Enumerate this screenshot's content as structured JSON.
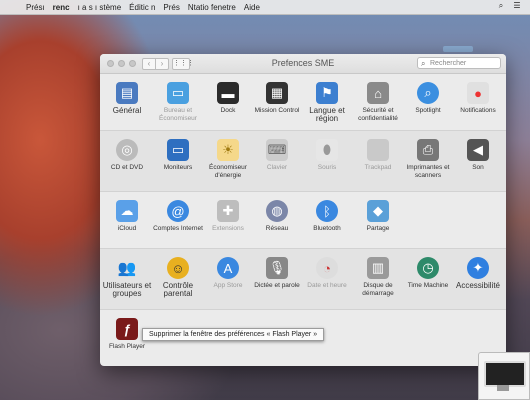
{
  "menubar": {
    "items": [
      "Présı",
      "renc",
      "ı a s ı stème",
      "Éditic n",
      "Prés",
      "Ntatio fenetre",
      "Aide"
    ]
  },
  "window": {
    "title": "Prefences SME",
    "search_placeholder": "Rechercher"
  },
  "row1": [
    {
      "name": "general",
      "label": "Général",
      "icon": "file-icon",
      "color": "#4a7ac0"
    },
    {
      "name": "bureau",
      "label": "Bureau et Économiseur",
      "icon": "desktop-icon",
      "color": "#4aa0e0"
    },
    {
      "name": "dock",
      "label": "Dock",
      "icon": "dock-icon",
      "color": "#2b2b2b"
    },
    {
      "name": "mission-control",
      "label": "Mission Control",
      "icon": "mission-icon",
      "color": "#333333"
    },
    {
      "name": "langue",
      "label": "Langue et région",
      "icon": "flag-icon",
      "color": "#3c7fd0"
    },
    {
      "name": "securite",
      "label": "Sécurité et confidentialité",
      "icon": "house-lock-icon",
      "color": "#8a8a8a"
    },
    {
      "name": "spotlight",
      "label": "Spotlight",
      "icon": "magnifier-icon",
      "color": "#3b8fe0"
    },
    {
      "name": "notifications",
      "label": "Notifications",
      "icon": "bell-badge-icon",
      "color": "#e0e0e0"
    }
  ],
  "row2": [
    {
      "name": "cd-dvd",
      "label": "CD et DVD",
      "icon": "disc-icon",
      "color": "#bbbbbb"
    },
    {
      "name": "moniteurs",
      "label": "Moniteurs",
      "icon": "monitor-icon",
      "color": "#2e6fc0"
    },
    {
      "name": "economiseur",
      "label": "Économiseur d'énergie",
      "icon": "bulb-icon",
      "color": "#f5d88a"
    },
    {
      "name": "clavier",
      "label": "Clavier",
      "icon": "keyboard-icon",
      "color": "#cccccc"
    },
    {
      "name": "souris",
      "label": "Souris",
      "icon": "mouse-icon",
      "color": "#e6e6e6"
    },
    {
      "name": "trackpad",
      "label": "Trackpad",
      "icon": "trackpad-icon",
      "color": "#c9c9c9"
    },
    {
      "name": "imprimantes",
      "label": "Imprimantes et scanners",
      "icon": "printer-icon",
      "color": "#777777"
    },
    {
      "name": "son",
      "label": "Son",
      "icon": "speaker-icon",
      "color": "#555555"
    }
  ],
  "row3": [
    {
      "name": "icloud",
      "label": "iCloud",
      "icon": "cloud-icon",
      "color": "#5aa0e8"
    },
    {
      "name": "comptes-internet",
      "label": "Comptes Internet",
      "icon": "at-icon",
      "color": "#3a88e0"
    },
    {
      "name": "extensions",
      "label": "Extensions",
      "icon": "puzzle-icon",
      "color": "#bdbdbd"
    },
    {
      "name": "reseau",
      "label": "Réseau",
      "icon": "globe-icon",
      "color": "#7b86a8"
    },
    {
      "name": "bluetooth",
      "label": "Bluetooth",
      "icon": "bluetooth-icon",
      "color": "#3a88e0"
    },
    {
      "name": "partage",
      "label": "Partage",
      "icon": "folder-sign-icon",
      "color": "#5aa0d8"
    }
  ],
  "row4": [
    {
      "name": "utilisateurs",
      "label": "Utilisateurs et groupes",
      "icon": "users-icon",
      "color": "#333333"
    },
    {
      "name": "controle-parental",
      "label": "Contrôle parental",
      "icon": "parental-icon",
      "color": "#e8b020"
    },
    {
      "name": "app-store",
      "label": "App Store",
      "icon": "appstore-icon",
      "color": "#3a88e0"
    },
    {
      "name": "dictee",
      "label": "Dictée et parole",
      "icon": "microphone-icon",
      "color": "#888888"
    },
    {
      "name": "date-heure",
      "label": "Date et heure",
      "icon": "clock-icon",
      "color": "#dddddd"
    },
    {
      "name": "disque-demarrage",
      "label": "Disque de démarrage",
      "icon": "harddisk-icon",
      "color": "#9a9a9a"
    },
    {
      "name": "time-machine",
      "label": "Time Machine",
      "icon": "timemachine-icon",
      "color": "#2e8a6a"
    },
    {
      "name": "accessibilite",
      "label": "Accessibilité",
      "icon": "accessibility-icon",
      "color": "#2f7fe0"
    }
  ],
  "row5": [
    {
      "name": "flash-player",
      "label": "Flash Player",
      "icon": "flash-icon",
      "color": "#7a1a1a"
    }
  ],
  "tooltip": "Supprimer la fenêtre des préférences « Flash Player »"
}
